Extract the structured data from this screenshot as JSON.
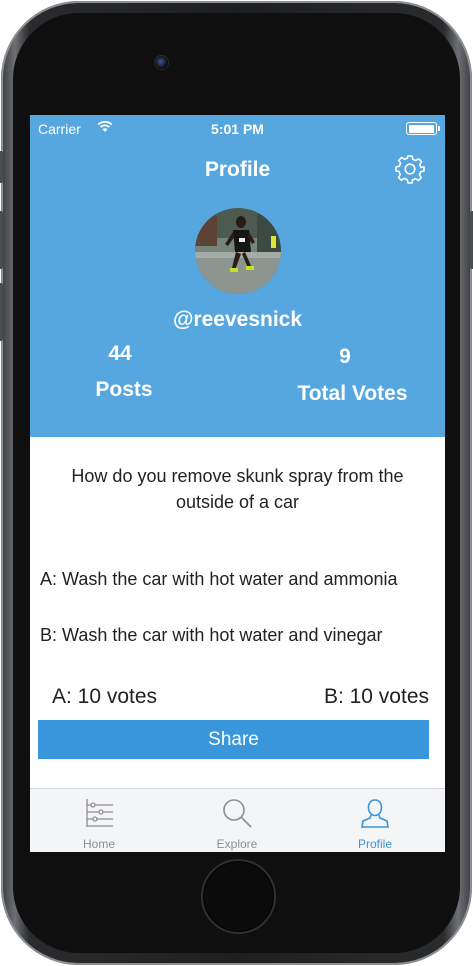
{
  "status_bar": {
    "carrier": "Carrier",
    "time": "5:01 PM",
    "battery_level": 1.0
  },
  "nav": {
    "title": "Profile",
    "settings_icon": "gear-icon"
  },
  "profile": {
    "username": "@reevesnick",
    "posts_count": "44",
    "posts_label": "Posts",
    "votes_count": "9",
    "votes_label": "Total Votes"
  },
  "post": {
    "question": "How do you remove skunk spray from the outside of a car",
    "option_a": "A: Wash the car with hot water and ammonia",
    "option_b": "B: Wash the car with hot water and vinegar",
    "votes_a": "A: 10 votes",
    "votes_b": "B: 10 votes",
    "share_label": "Share"
  },
  "tabbar": {
    "items": [
      {
        "label": "Home",
        "icon": "home-icon",
        "active": false
      },
      {
        "label": "Explore",
        "icon": "search-icon",
        "active": false
      },
      {
        "label": "Profile",
        "icon": "person-icon",
        "active": true
      }
    ]
  },
  "colors": {
    "header_bg": "#56a6df",
    "accent": "#3a96da",
    "tabbar_bg": "#f4f5f7",
    "inactive_tab": "#8e8e93"
  }
}
